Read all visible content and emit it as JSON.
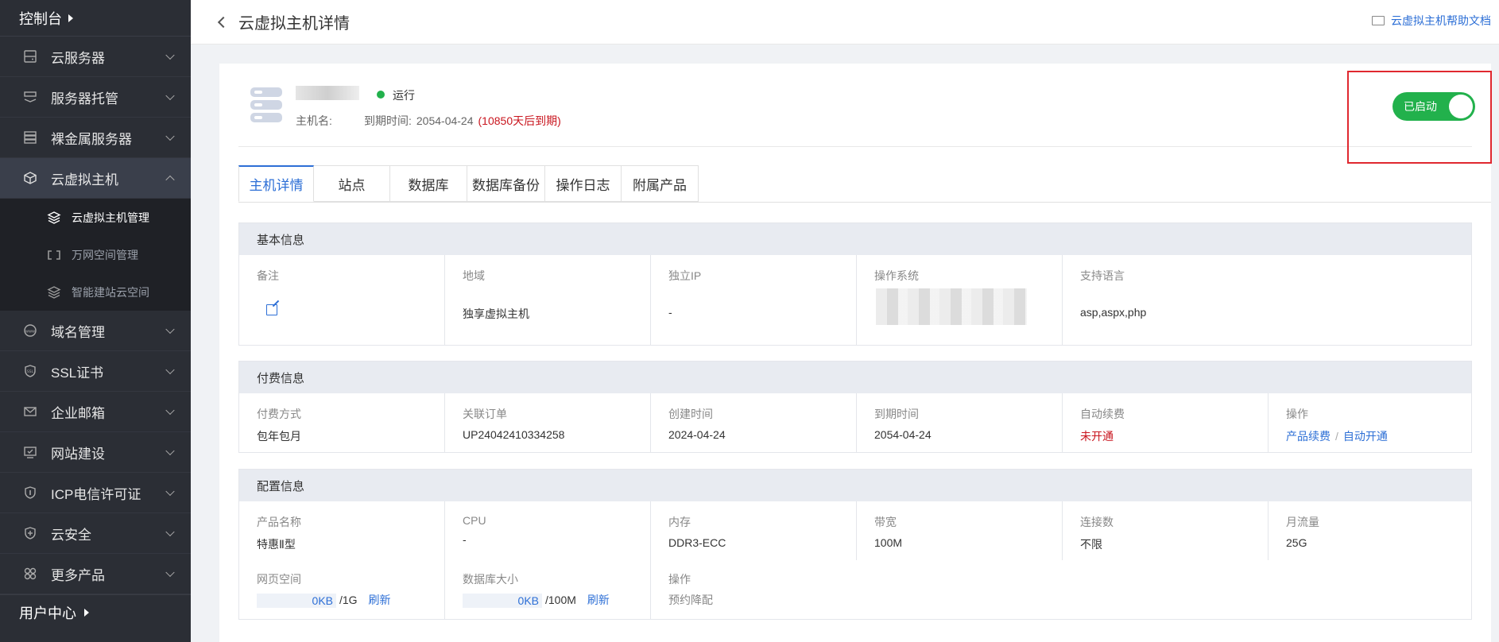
{
  "sidebar": {
    "top_label": "控制台",
    "items": [
      {
        "label": "云服务器",
        "icon": "server-icon"
      },
      {
        "label": "服务器托管",
        "icon": "hosting-icon"
      },
      {
        "label": "裸金属服务器",
        "icon": "bare-metal-icon"
      },
      {
        "label": "云虚拟主机",
        "icon": "cube-icon"
      }
    ],
    "sub_items": [
      {
        "label": "云虚拟主机管理",
        "icon": "layers-icon"
      },
      {
        "label": "万网空间管理",
        "icon": "bracket-icon"
      },
      {
        "label": "智能建站云空间",
        "icon": "layers-icon"
      }
    ],
    "items_after": [
      {
        "label": "域名管理",
        "icon": "www-icon"
      },
      {
        "label": "SSL证书",
        "icon": "ssl-icon"
      },
      {
        "label": "企业邮箱",
        "icon": "mail-icon"
      },
      {
        "label": "网站建设",
        "icon": "website-icon"
      },
      {
        "label": "ICP电信许可证",
        "icon": "icp-icon"
      },
      {
        "label": "云安全",
        "icon": "shield-icon"
      },
      {
        "label": "更多产品",
        "icon": "grid-icon"
      }
    ],
    "bottom_label": "用户中心"
  },
  "header": {
    "title": "云虚拟主机详情",
    "help_label": "云虚拟主机帮助文档"
  },
  "host": {
    "status": "运行",
    "host_label": "主机名:",
    "expire_label": "到期时间:",
    "expire_date": "2054-04-24",
    "expire_note": "(10850天后到期)",
    "toggle_label": "已启动"
  },
  "tabs": [
    "主机详情",
    "站点",
    "数据库",
    "数据库备份",
    "操作日志",
    "附属产品"
  ],
  "basic": {
    "title": "基本信息",
    "labels": [
      "备注",
      "地域",
      "独立IP",
      "操作系统",
      "支持语言"
    ],
    "values": [
      "",
      "独享虚拟主机",
      "-",
      "",
      "asp,aspx,php"
    ]
  },
  "billing": {
    "title": "付费信息",
    "labels": [
      "付费方式",
      "关联订单",
      "创建时间",
      "到期时间",
      "自动续费",
      "操作"
    ],
    "values": [
      "包年包月",
      "UP24042410334258",
      "2024-04-24",
      "2054-04-24",
      "未开通",
      ""
    ],
    "action_renew": "产品续费",
    "action_sep": "/",
    "action_auto": "自动开通"
  },
  "config": {
    "title": "配置信息",
    "labels": [
      "产品名称",
      "CPU",
      "内存",
      "带宽",
      "连接数",
      "月流量"
    ],
    "values": [
      "特惠Ⅱ型",
      "-",
      "DDR3-ECC",
      "100M",
      "不限",
      "25G"
    ],
    "row2_labels": [
      "网页空间",
      "数据库大小",
      "操作"
    ],
    "web_used": "0KB",
    "web_total": "/1G",
    "db_used": "0KB",
    "db_total": "/100M",
    "refresh": "刷新",
    "downgrade": "预约降配"
  },
  "colors": {
    "accent": "#2d6fd6",
    "success": "#22b14c",
    "danger": "#c9151e",
    "sidebar": "#2b2e35"
  }
}
